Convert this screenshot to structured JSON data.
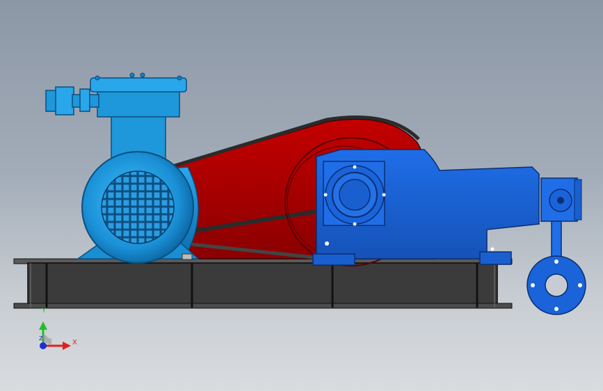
{
  "view": {
    "background_top": "#8c97a6",
    "background_bottom": "#d9dcdf"
  },
  "model": {
    "motor_color": "#1d9ee0",
    "belt_guard_color": "#b30000",
    "pump_color": "#1a63d9",
    "base_color": "#3d3d3d"
  },
  "triad": {
    "y_label": "Y",
    "x_label": "X",
    "z_label": "Z",
    "x_color": "#e0201a",
    "y_color": "#1fbf2a",
    "z_color": "#1b2fd6"
  }
}
